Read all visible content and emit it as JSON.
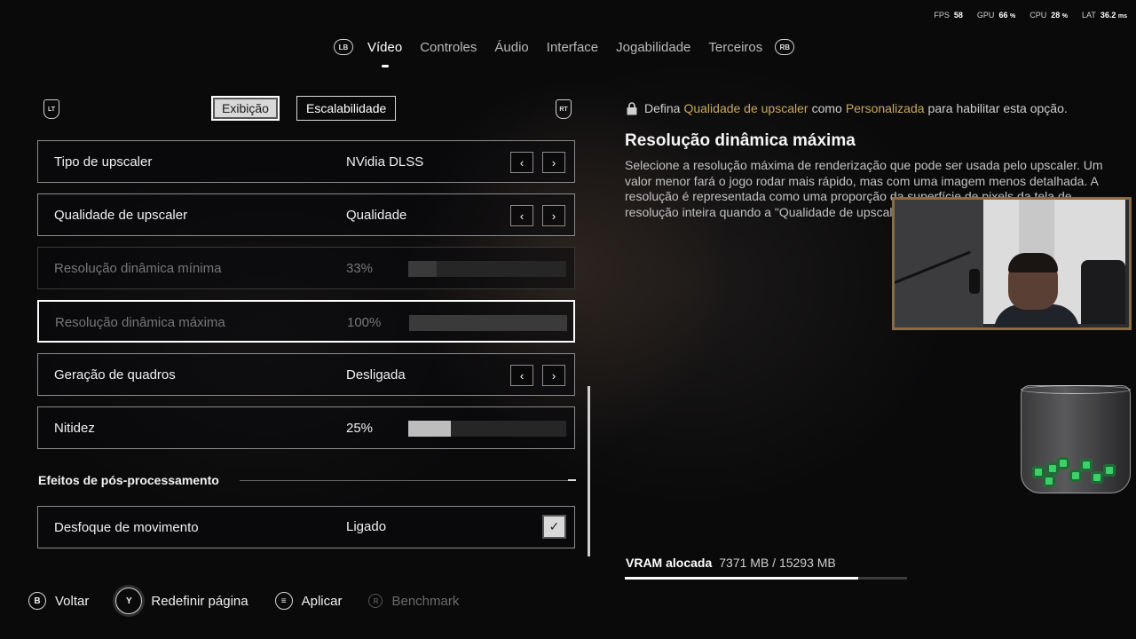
{
  "perf": {
    "fps_label": "FPS",
    "fps": "58",
    "gpu_label": "GPU",
    "gpu": "66",
    "gpu_unit": "%",
    "cpu_label": "CPU",
    "cpu": "28",
    "cpu_unit": "%",
    "lat_label": "LAT",
    "lat": "36.2",
    "lat_unit": "ms"
  },
  "topnav": {
    "left_bumper": "LB",
    "right_bumper": "RB",
    "tabs": [
      "Vídeo",
      "Controles",
      "Áudio",
      "Interface",
      "Jogabilidade",
      "Terceiros"
    ],
    "active_tab": "Vídeo"
  },
  "subnav": {
    "left_trigger": "LT",
    "right_trigger": "RT",
    "tabs": [
      "Exibição",
      "Escalabilidade"
    ],
    "active_tab": "Exibição"
  },
  "settings": [
    {
      "label": "Tipo de upscaler",
      "value": "NVidia DLSS",
      "type": "selector",
      "state": "enabled"
    },
    {
      "label": "Qualidade de upscaler",
      "value": "Qualidade",
      "type": "selector",
      "state": "enabled"
    },
    {
      "label": "Resolução dinâmica mínima",
      "value": "33%",
      "type": "slider",
      "level": 0.18,
      "state": "disabled"
    },
    {
      "label": "Resolução dinâmica máxima",
      "value": "100%",
      "type": "slider",
      "level": 1.0,
      "state": "disabled-selected"
    },
    {
      "label": "Geração de quadros",
      "value": "Desligada",
      "type": "selector",
      "state": "enabled"
    },
    {
      "label": "Nitidez",
      "value": "25%",
      "type": "slider",
      "level": 0.27,
      "state": "enabled"
    }
  ],
  "section": {
    "title": "Efeitos de pós-processamento",
    "items": [
      {
        "label": "Desfoque de movimento",
        "value": "Ligado",
        "type": "checkbox",
        "checked": true
      }
    ]
  },
  "info": {
    "lock_prefix": "Defina",
    "lock_gold1": "Qualidade de upscaler",
    "lock_mid": "como",
    "lock_gold2": "Personalizada",
    "lock_suffix": "para habilitar esta opção.",
    "title": "Resolução dinâmica máxima",
    "body": "Selecione a resolução máxima de renderização que pode ser usada pelo upscaler. Um valor menor fará o jogo rodar mais rápido, mas com uma imagem menos detalhada. A resolução é representada como uma proporção da superfície de pixels da tela de resolução inteira quando a \"Qualidade de upscaler\" for \"Personalizada\"."
  },
  "vram": {
    "label": "VRAM alocada",
    "value": "7371 MB / 15293 MB",
    "used_fraction": 0.48
  },
  "bottom": [
    {
      "key": "B",
      "label": "Voltar",
      "enabled": true
    },
    {
      "key": "Y",
      "label": "Redefinir página",
      "enabled": true
    },
    {
      "key": "≡",
      "label": "Aplicar",
      "enabled": true
    },
    {
      "key": "R",
      "label": "Benchmark",
      "enabled": false
    }
  ],
  "colors": {
    "accent_gold": "#c9a95a",
    "background": "#0b0b0c",
    "slider_fill": "#bdbdbd",
    "cam_border": "#8a6b45"
  }
}
